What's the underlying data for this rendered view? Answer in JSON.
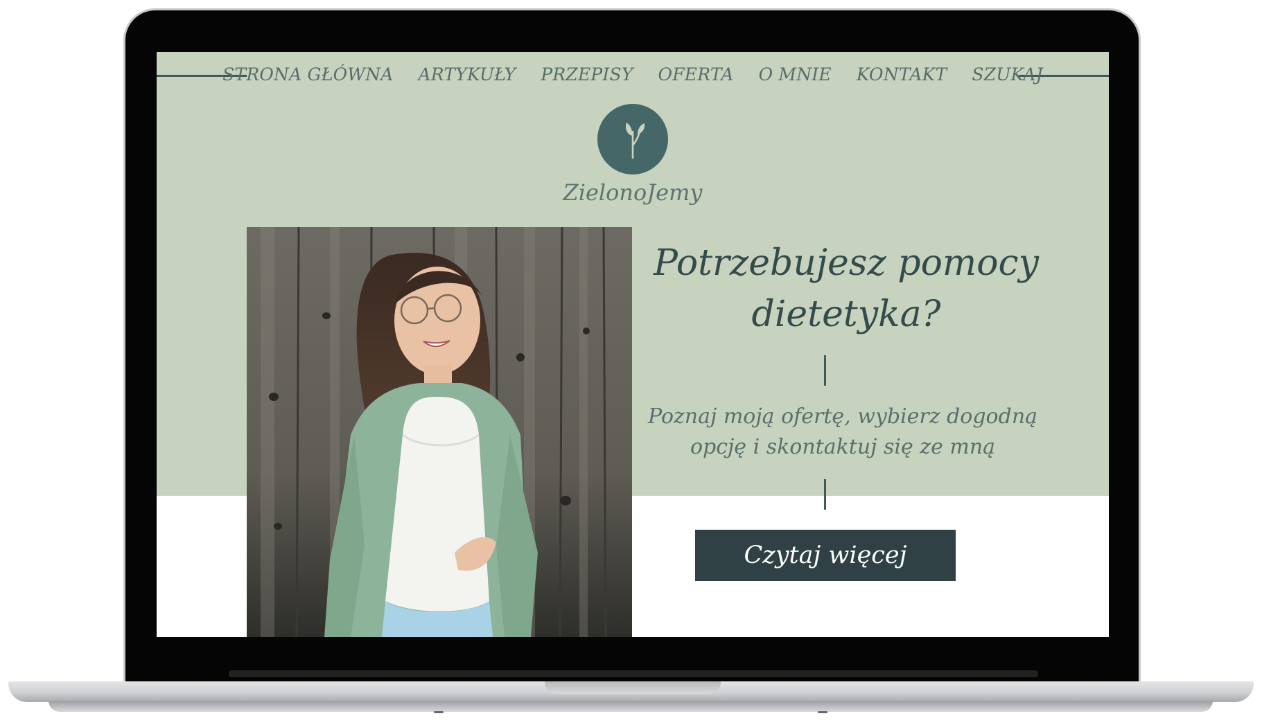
{
  "nav": {
    "items": [
      {
        "label": "STRONA GŁÓWNA"
      },
      {
        "label": "ARTYKUŁY"
      },
      {
        "label": "PRZEPISY"
      },
      {
        "label": "OFERTA"
      },
      {
        "label": "O MNIE"
      },
      {
        "label": "KONTAKT"
      },
      {
        "label": "SZUKAJ"
      }
    ]
  },
  "brand": {
    "name": "ZielonoJemy",
    "logo_icon": "sprout-icon"
  },
  "hero": {
    "headline": "Potrzebujesz pomocy dietetyka?",
    "subtext": "Poznaj moją ofertę, wybierz dogodną opcję i skontaktuj się ze mną",
    "cta_label": "Czytaj więcej",
    "photo": "portrait-photo"
  },
  "colors": {
    "hero_background": "#c7d3bf",
    "accent": "#456767",
    "cta_background": "#2f4144",
    "nav_text": "#586d6a",
    "headline_text": "#344b4b"
  }
}
